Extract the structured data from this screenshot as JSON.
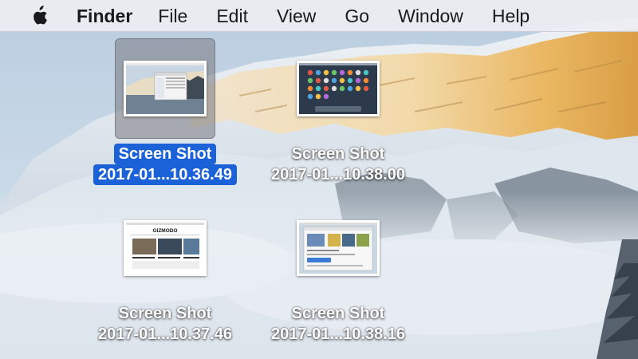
{
  "menubar": {
    "apple_icon": "apple-logo-icon",
    "app_name": "Finder",
    "items": [
      "File",
      "Edit",
      "View",
      "Go",
      "Window",
      "Help"
    ]
  },
  "desktop": {
    "files": [
      {
        "name_line1": "Screen Shot",
        "name_line2": "2017-01...10.36.49",
        "selected": true
      },
      {
        "name_line1": "Screen Shot",
        "name_line2": "2017-01...10.38.00",
        "selected": false
      },
      {
        "name_line1": "Screen Shot",
        "name_line2": "2017-01...10.37.46",
        "selected": false
      },
      {
        "name_line1": "Screen Shot",
        "name_line2": "2017-01...10.38.16",
        "selected": false
      }
    ],
    "thumbnail_texts": {
      "gizmodo_logo": "GIZMODO"
    }
  },
  "colors": {
    "selection_blue": "#1b62d8",
    "menubar_bg": "#eceef2",
    "sky": "#bfd3e6",
    "mountain_gold": "#e8b55c"
  }
}
